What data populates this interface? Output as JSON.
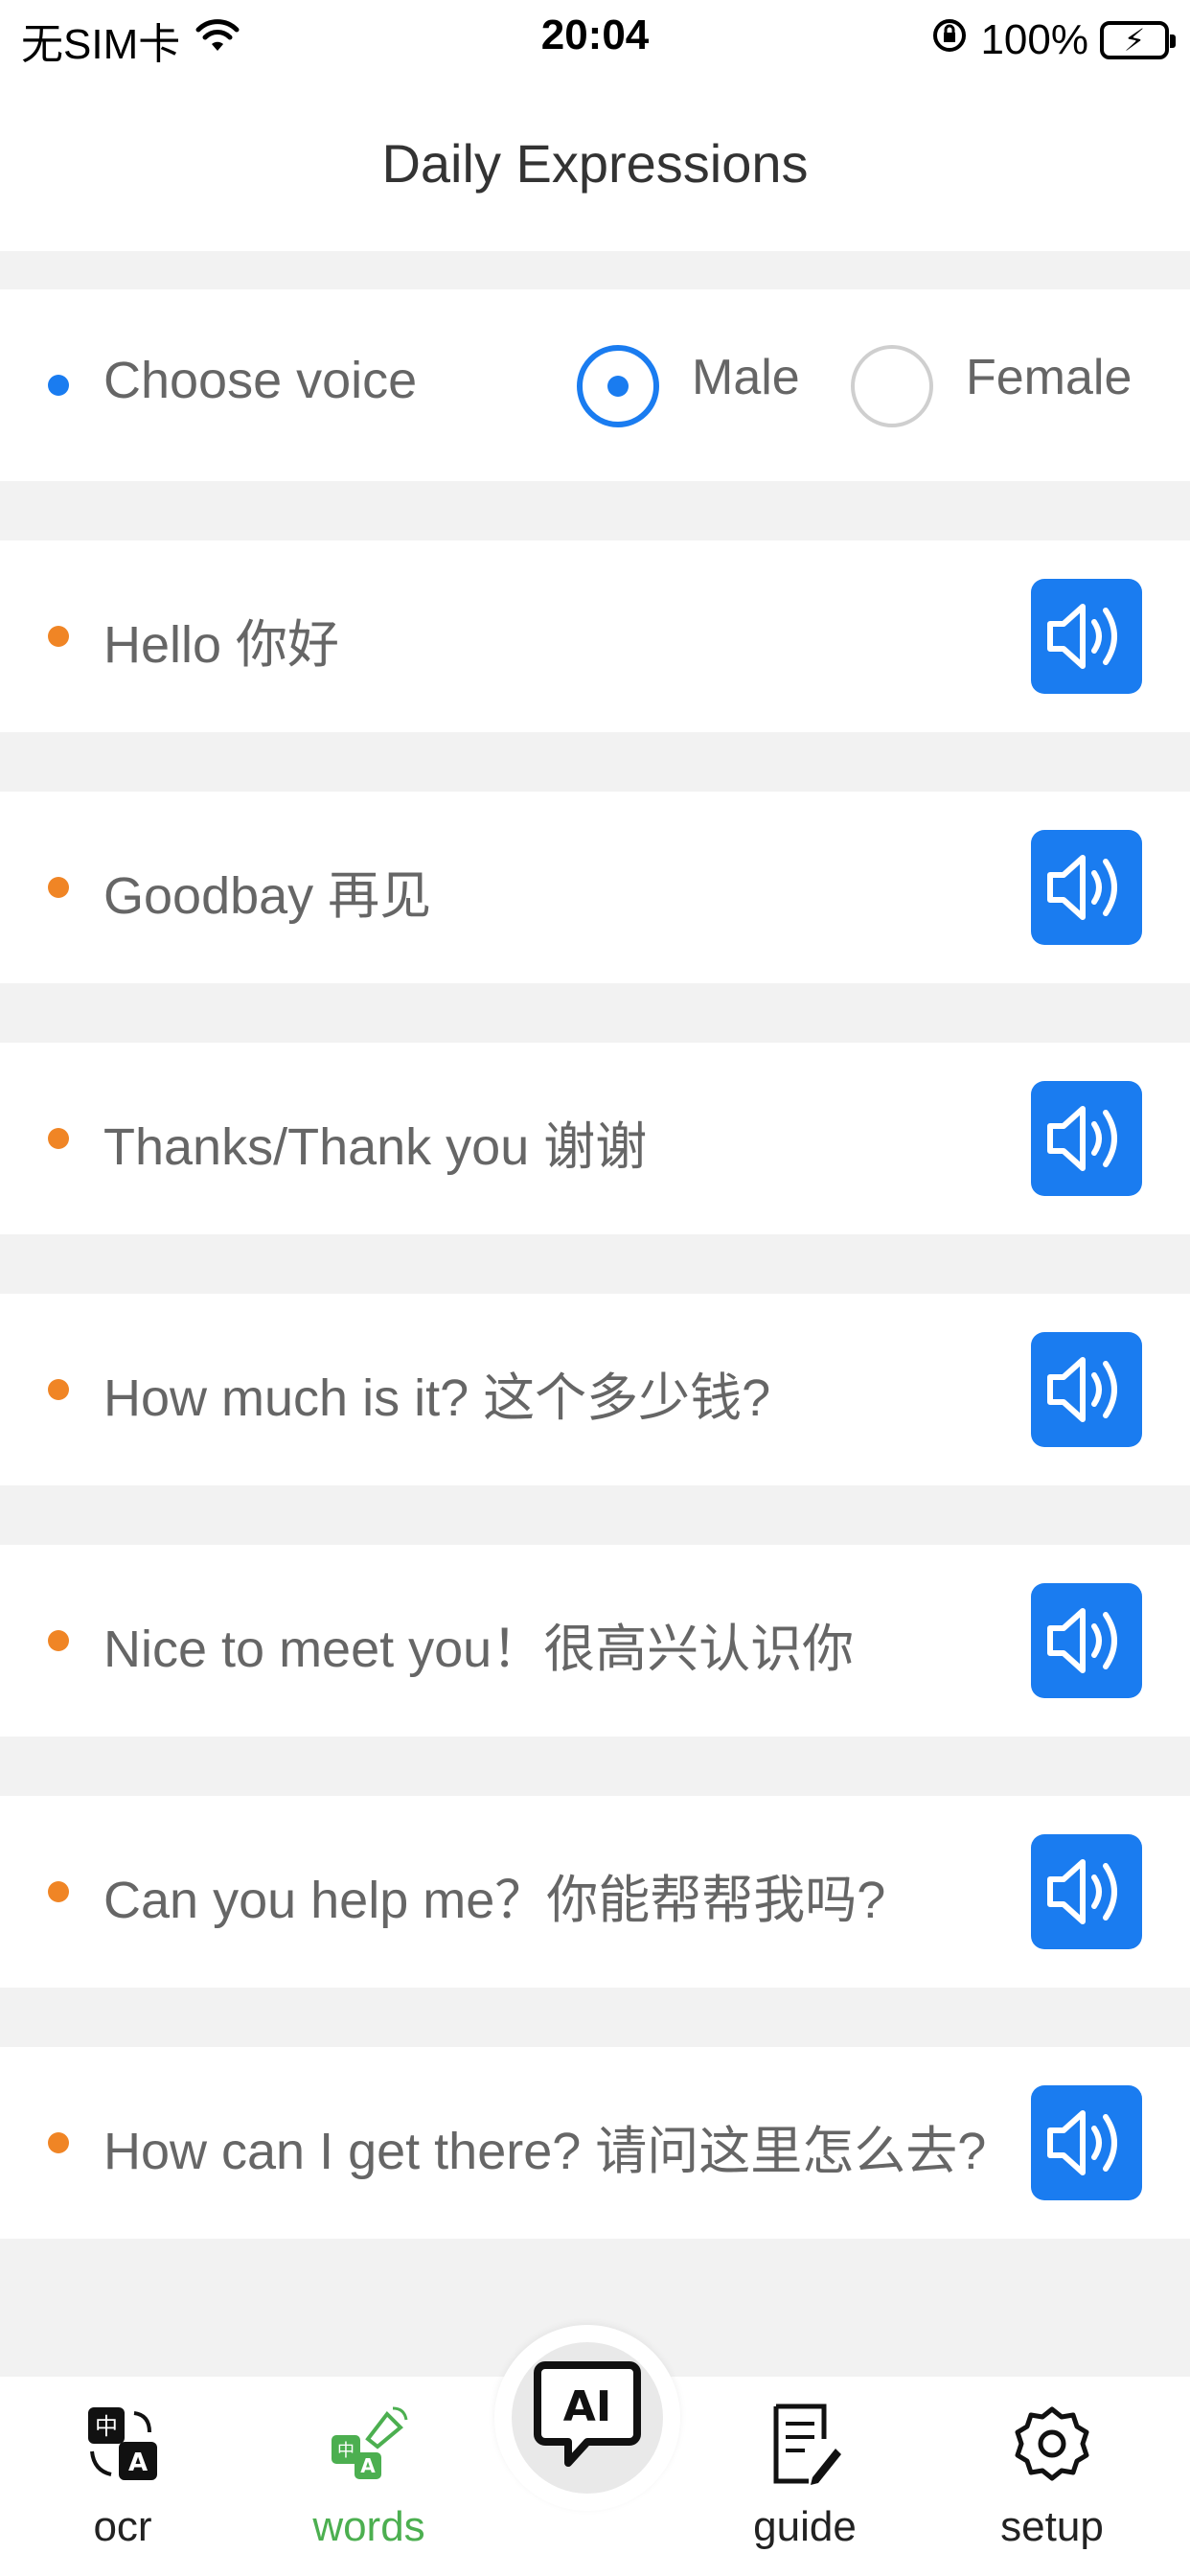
{
  "status_bar": {
    "carrier": "无SIM卡",
    "time": "20:04",
    "battery": "100%",
    "battery_color": "#34c759"
  },
  "header": {
    "title": "Daily Expressions"
  },
  "voice": {
    "label": "Choose voice",
    "options": [
      "Male",
      "Female"
    ],
    "selected": "Male"
  },
  "expressions": [
    {
      "text": "Hello 你好"
    },
    {
      "text": "Goodbay 再见"
    },
    {
      "text": "Thanks/Thank you 谢谢"
    },
    {
      "text": "How much is it? 这个多少钱?"
    },
    {
      "text": "Nice to meet you！很高兴认识你"
    },
    {
      "text": "Can you help me？你能帮帮我吗?"
    },
    {
      "text": "How can I get there? 请问这里怎么去?"
    }
  ],
  "tabbar": {
    "items": [
      {
        "label": "ocr",
        "icon": "translate-icon"
      },
      {
        "label": "words",
        "icon": "speaker-translate-icon",
        "active": true
      },
      {
        "label": "",
        "icon": "ai-chat-icon"
      },
      {
        "label": "guide",
        "icon": "document-edit-icon"
      },
      {
        "label": "setup",
        "icon": "gear-icon"
      }
    ],
    "ai_label": "AI",
    "active_color": "#4caf50"
  },
  "colors": {
    "accent": "#1a7cf0",
    "bullet_orange": "#f08525"
  }
}
